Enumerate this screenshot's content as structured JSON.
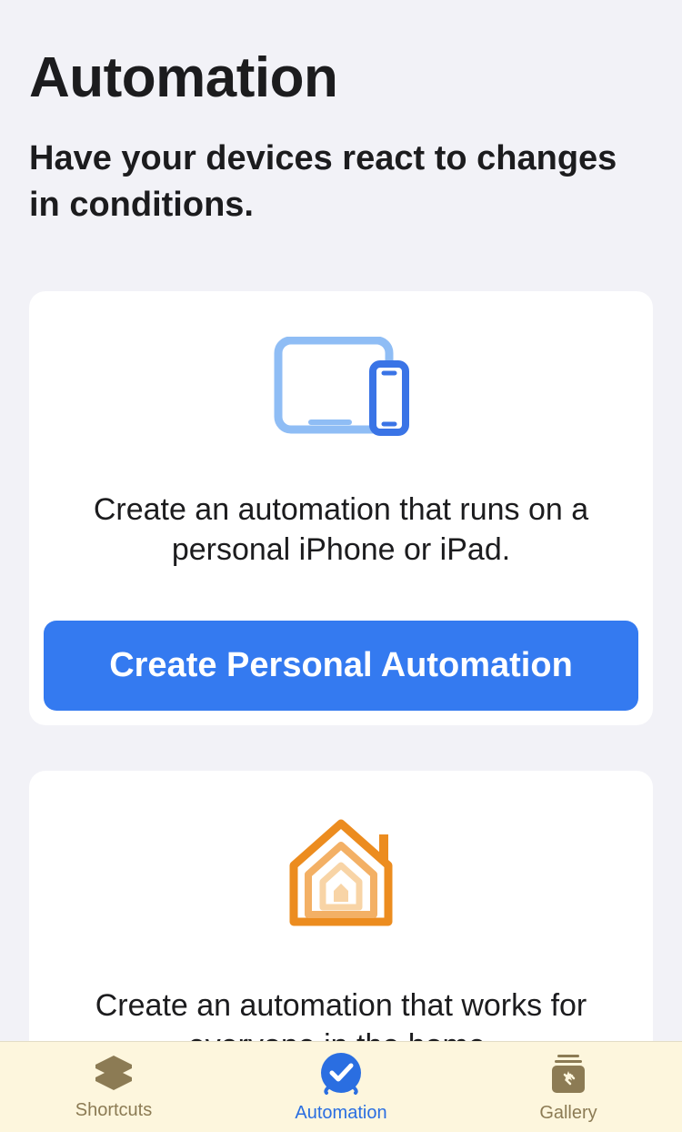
{
  "header": {
    "title": "Automation",
    "subtitle": "Have your devices react to changes in conditions."
  },
  "cards": {
    "personal": {
      "description": "Create an automation that runs on a personal iPhone or iPad.",
      "button_label": "Create Personal Automation"
    },
    "home": {
      "description": "Create an automation that works for everyone in the home."
    }
  },
  "tabs": {
    "shortcuts": {
      "label": "Shortcuts"
    },
    "automation": {
      "label": "Automation"
    },
    "gallery": {
      "label": "Gallery"
    }
  }
}
